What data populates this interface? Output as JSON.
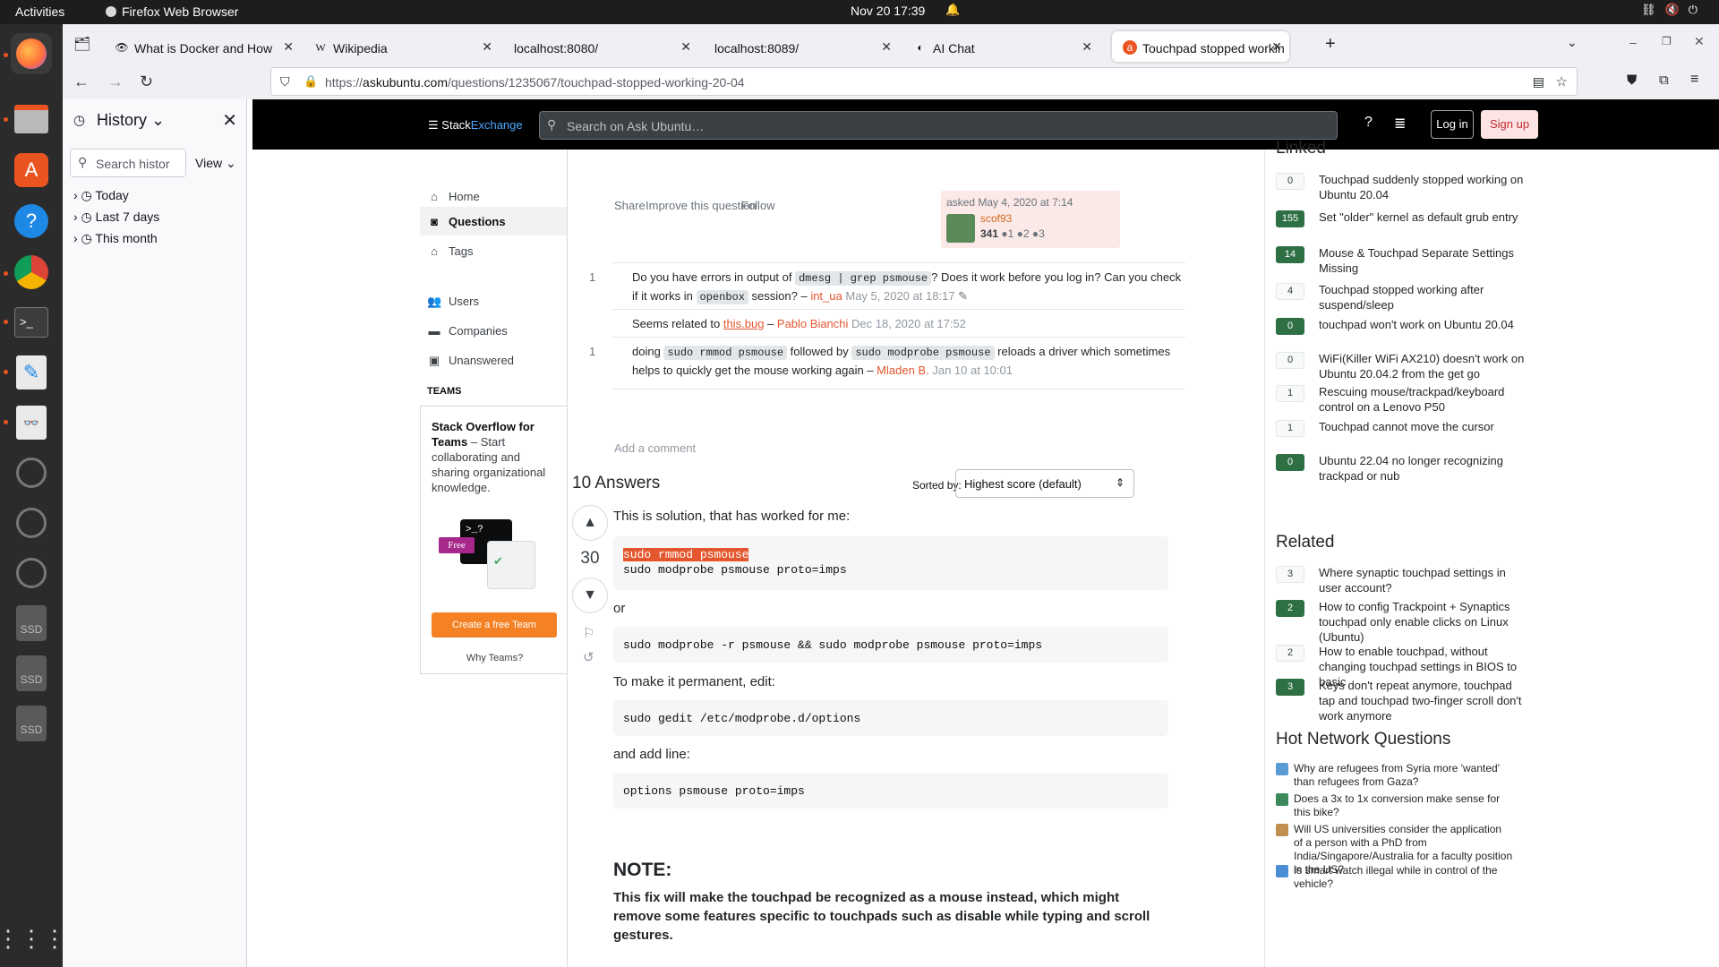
{
  "topbar": {
    "activities": "Activities",
    "app": "Firefox Web Browser",
    "clock": "Nov 20  17:39"
  },
  "tabs": [
    {
      "label": "What is Docker and How",
      "icon": "docker-icon"
    },
    {
      "label": "Wikipedia",
      "icon": "wikipedia-icon"
    },
    {
      "label": "localhost:8080/",
      "icon": ""
    },
    {
      "label": "localhost:8089/",
      "icon": ""
    },
    {
      "label": "AI Chat",
      "icon": "ai-chat-icon"
    },
    {
      "label": "Touchpad stopped workin",
      "icon": "askubuntu-icon"
    }
  ],
  "urlbar": {
    "host_prefix": "https://",
    "host": "askubuntu.com",
    "path": "/questions/1235067/touchpad-stopped-working-20-04"
  },
  "history": {
    "title": "History",
    "search_placeholder": "Search histor",
    "view_label": "View",
    "groups": [
      "Today",
      "Last 7 days",
      "This month"
    ]
  },
  "se_header": {
    "logo_a": "Stack",
    "logo_b": "Exchange",
    "search_placeholder": "Search on Ask Ubuntu…",
    "login": "Log in",
    "signup": "Sign up"
  },
  "leftnav": {
    "items": [
      "Home",
      "Questions",
      "Tags",
      "Users",
      "Companies",
      "Unanswered"
    ],
    "teams_header": "TEAMS",
    "teams_title": "Stack Overflow for Teams",
    "teams_desc": " – Start collaborating and sharing organizational knowledge.",
    "teams_free": "Free",
    "teams_button": "Create a free Team",
    "why_teams": "Why Teams?"
  },
  "question": {
    "links": [
      "Share",
      "Improve this question",
      "Follow"
    ],
    "asked": "asked May 4, 2020 at 7:14",
    "user": "scof93",
    "rep": "341",
    "badges": "●1 ●2 ●3"
  },
  "comments": [
    {
      "score": "1",
      "pre": "Do you have errors in output of ",
      "code1": "dmesg | grep psmouse",
      "mid": "? Does it work before you log in? Can you check if it works in ",
      "code2": "openbox",
      "post": " session? – ",
      "author": "int_ua",
      "time": "May 5, 2020 at 18:17"
    },
    {
      "score": "",
      "pre": "Seems related to ",
      "link": "this.bug",
      "post": " – ",
      "author": "Pablo Bianchi",
      "time": "Dec 18, 2020 at 17:52"
    },
    {
      "score": "1",
      "pre": "doing ",
      "code1": "sudo rmmod psmouse",
      "mid": " followed by ",
      "code2": "sudo modprobe psmouse",
      "post": " reloads a driver which sometimes helps to quickly get the mouse working again – ",
      "author": "Mladen B.",
      "time": "Jan 10 at 10:01"
    }
  ],
  "add_comment": "Add a comment",
  "answers": {
    "header": "10 Answers",
    "sorted_by": "Sorted by:",
    "sort_value": "Highest score (default)",
    "votes": "30",
    "p1": "This is solution, that has worked for me:",
    "code1_line1": "sudo rmmod psmouse",
    "code1_line2": "sudo modprobe psmouse proto=imps",
    "p2": "or",
    "code2": "sudo modprobe -r psmouse && sudo modprobe psmouse proto=imps",
    "p3": "To make it permanent, edit:",
    "code3": "sudo gedit /etc/modprobe.d/options",
    "p4": "and add line:",
    "code4": "options psmouse proto=imps",
    "note_title": "NOTE:",
    "note_body": "This fix will make the touchpad be recognized as a mouse instead, which might remove some features specific to touchpads such as disable while typing and scroll gestures."
  },
  "linked": {
    "title": "Linked",
    "items": [
      {
        "n": "0",
        "t": "Touchpad suddenly stopped working on Ubuntu 20.04",
        "g": false
      },
      {
        "n": "155",
        "t": "Set \"older\" kernel as default grub entry",
        "g": true
      },
      {
        "n": "14",
        "t": "Mouse & Touchpad Separate Settings Missing",
        "g": true
      },
      {
        "n": "4",
        "t": "Touchpad stopped working after suspend/sleep",
        "g": false
      },
      {
        "n": "0",
        "t": "touchpad won't work on Ubuntu 20.04",
        "g": true
      },
      {
        "n": "0",
        "t": "WiFi(Killer WiFi AX210) doesn't work on Ubuntu 20.04.2 from the get go",
        "g": false
      },
      {
        "n": "1",
        "t": "Rescuing mouse/trackpad/keyboard control on a Lenovo P50",
        "g": false
      },
      {
        "n": "1",
        "t": "Touchpad cannot move the cursor",
        "g": false
      },
      {
        "n": "0",
        "t": "Ubuntu 22.04 no longer recognizing trackpad or nub",
        "g": true
      }
    ]
  },
  "related": {
    "title": "Related",
    "items": [
      {
        "n": "3",
        "t": "Where synaptic touchpad settings in user account?",
        "g": false
      },
      {
        "n": "2",
        "t": "How to config Trackpoint + Synaptics touchpad only enable clicks on Linux (Ubuntu)",
        "g": true
      },
      {
        "n": "2",
        "t": "How to enable touchpad, without changing touchpad settings in BIOS to basic",
        "g": false
      },
      {
        "n": "3",
        "t": "Keys don't repeat anymore, touchpad tap and touchpad two-finger scroll don't work anymore",
        "g": true
      }
    ]
  },
  "hnq": {
    "title": "Hot Network Questions",
    "items": [
      {
        "t": "Why are refugees from Syria more 'wanted' than refugees from Gaza?",
        "c": "#5b9bd5"
      },
      {
        "t": "Does a 3x to 1x conversion make sense for this bike?",
        "c": "#3c8a5c"
      },
      {
        "t": "Will US universities consider the application of a person with a PhD from India/Singapore/Australia for a faculty position in the US?",
        "c": "#c09050"
      },
      {
        "t": "Is smart watch illegal while in control of the vehicle?",
        "c": "#4a8fd6"
      }
    ]
  }
}
